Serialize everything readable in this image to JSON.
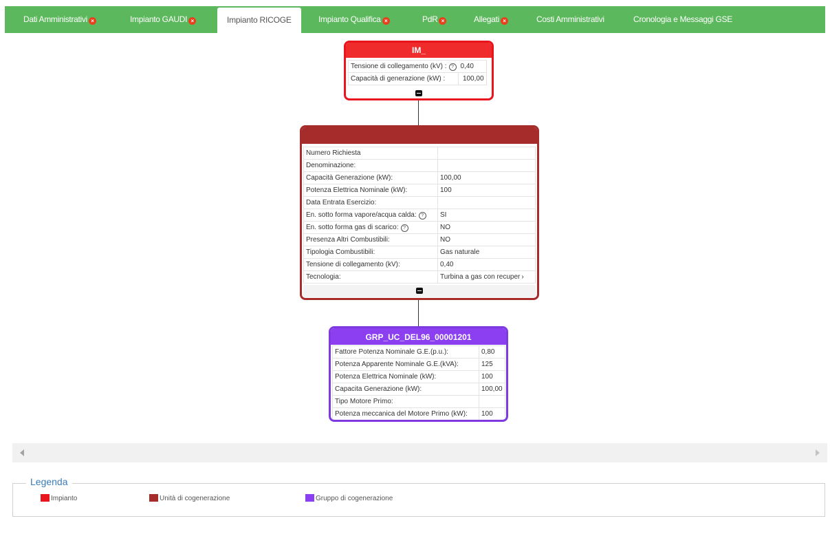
{
  "tabs": [
    {
      "label": "Dati Amministrativi",
      "error": true
    },
    {
      "label": "Impianto GAUDI",
      "error": true
    },
    {
      "label": "Impianto RICOGE",
      "error": false,
      "active": true
    },
    {
      "label": "Impianto Qualifica",
      "error": true
    },
    {
      "label": "PdR",
      "error": true
    },
    {
      "label": "Allegati",
      "error": true
    },
    {
      "label": "Costi Amministrativi",
      "error": false
    },
    {
      "label": "Cronologia e Messaggi GSE",
      "error": false
    }
  ],
  "error_icon": "x-circle-icon",
  "node_impianto": {
    "title": "IM_",
    "rows": [
      {
        "label": "Tensione di collegamento (kV) :",
        "value": "0,40",
        "help": true
      },
      {
        "label": "Capacità di generazione (kW) :",
        "value": "100,00",
        "help": false
      }
    ]
  },
  "node_unita": {
    "title": "",
    "rows": [
      {
        "label": "Numero Richiesta",
        "value": ""
      },
      {
        "label": "Denominazione:",
        "value": ""
      },
      {
        "label": "Capacità Generazione (kW):",
        "value": "100,00"
      },
      {
        "label": "Potenza Elettrica Nominale (kW):",
        "value": "100"
      },
      {
        "label": "Data Entrata Esercizio:",
        "value": ""
      },
      {
        "label": "En. sotto forma vapore/acqua calda:",
        "value": "SI",
        "help": true
      },
      {
        "label": "En. sotto forma gas di scarico:",
        "value": "NO",
        "help": true
      },
      {
        "label": "Presenza Altri Combustibili:",
        "value": "NO"
      },
      {
        "label": "Tipologia Combustibili:",
        "value": "Gas naturale"
      },
      {
        "label": "Tensione di collegamento (kV):",
        "value": "0,40"
      },
      {
        "label": "Tecnologia:",
        "value": "Turbina a gas con recuper"
      }
    ]
  },
  "node_gruppo": {
    "title": "GRP_UC_DEL96_00001201",
    "rows": [
      {
        "label": "Fattore Potenza Nominale G.E.(p.u.):",
        "value": "0,80"
      },
      {
        "label": "Potenza Apparente Nominale G.E.(kVA):",
        "value": "125"
      },
      {
        "label": "Potenza Elettrica Nominale (kW):",
        "value": "100"
      },
      {
        "label": "Capacita Generazione (kW):",
        "value": "100,00"
      },
      {
        "label": "Tipo Motore Primo:",
        "value": ""
      },
      {
        "label": "Potenza meccanica del Motore Primo (kW):",
        "value": "100"
      }
    ]
  },
  "legend": {
    "title": "Legenda",
    "items": [
      {
        "label": "Impianto",
        "color": "#e8141e"
      },
      {
        "label": "Unità di cogenerazione",
        "color": "#a62b2b"
      },
      {
        "label": "Gruppo di cogenerazione",
        "color": "#8c3ff0"
      }
    ]
  },
  "colors": {
    "tab_bar": "#5cb85c",
    "error": "#e8401c",
    "legend_title": "#3a7bb8"
  }
}
